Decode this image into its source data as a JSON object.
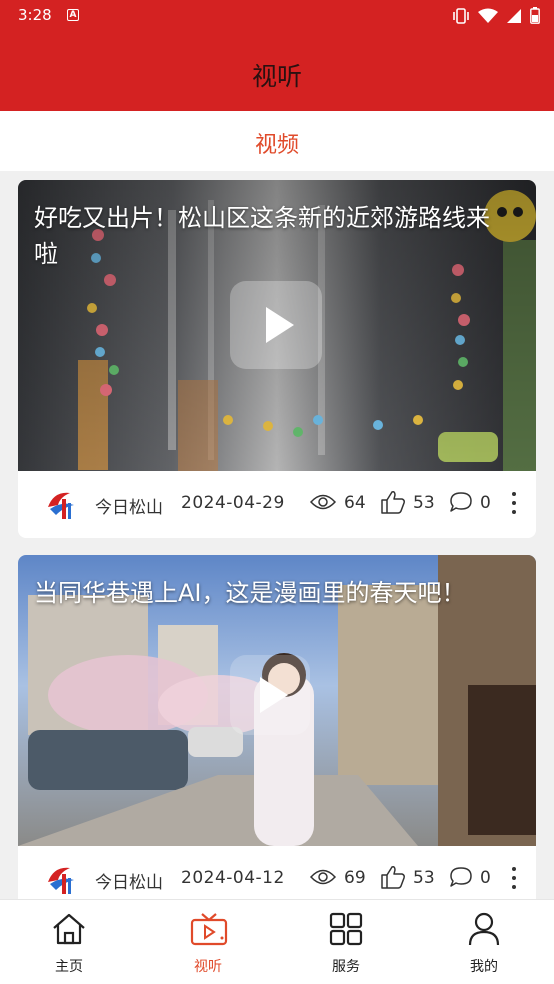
{
  "status_bar": {
    "time": "3:28",
    "notification_icon": "a-icon",
    "icons": [
      "vibrate-icon",
      "wifi-icon",
      "signal-icon",
      "battery-icon"
    ]
  },
  "header": {
    "title": "视听"
  },
  "tabs": [
    {
      "label": "视频",
      "active": true
    }
  ],
  "videos": [
    {
      "title": "好吃又出片！松山区这条新的近郊游路线来啦",
      "source": "今日松山",
      "date": "2024-04-29",
      "views": "64",
      "likes": "53",
      "comments": "0"
    },
    {
      "title": "当同华巷遇上AI，这是漫画里的春天吧！",
      "source": "今日松山",
      "date": "2024-04-12",
      "views": "69",
      "likes": "53",
      "comments": "0"
    }
  ],
  "bottom_nav": [
    {
      "label": "主页",
      "icon": "home-icon",
      "active": false
    },
    {
      "label": "视听",
      "icon": "tv-icon",
      "active": true
    },
    {
      "label": "服务",
      "icon": "grid-icon",
      "active": false
    },
    {
      "label": "我的",
      "icon": "person-icon",
      "active": false
    }
  ],
  "colors": {
    "brand_red": "#d42222",
    "active_tab": "#e04a2a",
    "background": "#f0f0f0"
  }
}
